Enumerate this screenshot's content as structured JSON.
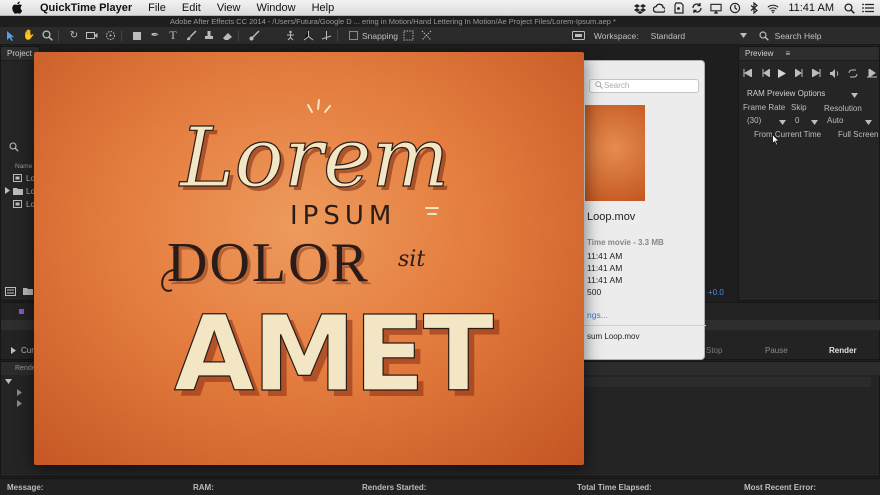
{
  "menubar": {
    "app_name": "QuickTime Player",
    "menus": [
      "File",
      "Edit",
      "View",
      "Window",
      "Help"
    ],
    "clock": "11:41 AM",
    "status_icons": [
      "dropbox-icon",
      "creative-cloud-icon",
      "evernote-icon",
      "sync-icon",
      "airplay-icon",
      "time-machine-icon",
      "bluetooth-icon",
      "wifi-icon",
      "search-icon",
      "list-icon"
    ]
  },
  "ae": {
    "title_path": "Adobe After Effects CC 2014 - /Users/Futura/Google D ... ering in Motion/Hand Lettering In Motion/Ae Project Files/Lorem-Ipsum.aep *",
    "snapping_label": "Snapping",
    "workspace_label": "Workspace:",
    "workspace_value": "Standard",
    "search_help": "Search Help",
    "project_tab": "Project",
    "project_name_header": "Name",
    "project_rows": [
      "Lo",
      "Lo",
      "Lo"
    ],
    "preview": {
      "tab": "Preview",
      "ram_options": "RAM Preview Options",
      "frame_rate_label": "Frame Rate",
      "skip_label": "Skip",
      "resolution_label": "Resolution",
      "frame_rate_value": "(30)",
      "skip_value": "0",
      "resolution_value": "Auto",
      "from_current": "From Current Time",
      "full_screen": "Full Screen"
    },
    "timecode_offset": "+0.0",
    "render_queue": {
      "current_label": "Curr",
      "renders_label": "Rende",
      "stop": "Stop",
      "pause": "Pause",
      "render": "Render"
    },
    "footer": {
      "message": "Message:",
      "ram": "RAM:",
      "renders_started": "Renders Started:",
      "total_time": "Total Time Elapsed:",
      "recent_error": "Most Recent Error:"
    }
  },
  "finder_info": {
    "search_placeholder": "Search",
    "file_name": "Loop.mov",
    "kind_size": "Time movie - 3.3 MB",
    "created": "11:41 AM",
    "modified": "11:41 AM",
    "last_opened": "11:41 AM",
    "dimensions": "500",
    "more_link": "ngs...",
    "full_name": "sum Loop.mov"
  },
  "video": {
    "line1": "Lorem",
    "line2": "IPSUM",
    "line3": "DOLOR",
    "line3_script": "sit",
    "line4": "AMET"
  },
  "colors": {
    "video_orange": "#e57a3a",
    "lettering_cream": "#f3e6c4",
    "lettering_dark": "#2a1c18",
    "ae_panel": "#252525"
  }
}
